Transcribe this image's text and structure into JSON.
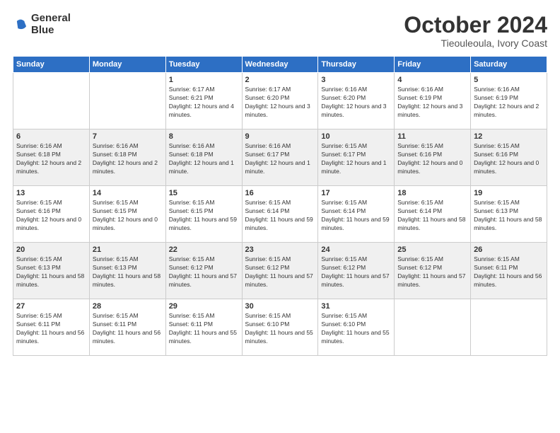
{
  "logo": {
    "line1": "General",
    "line2": "Blue"
  },
  "title": {
    "month": "October 2024",
    "location": "Tieouleoula, Ivory Coast"
  },
  "weekdays": [
    "Sunday",
    "Monday",
    "Tuesday",
    "Wednesday",
    "Thursday",
    "Friday",
    "Saturday"
  ],
  "weeks": [
    [
      {
        "day": "",
        "sunrise": "",
        "sunset": "",
        "daylight": ""
      },
      {
        "day": "",
        "sunrise": "",
        "sunset": "",
        "daylight": ""
      },
      {
        "day": "1",
        "sunrise": "Sunrise: 6:17 AM",
        "sunset": "Sunset: 6:21 PM",
        "daylight": "Daylight: 12 hours and 4 minutes."
      },
      {
        "day": "2",
        "sunrise": "Sunrise: 6:17 AM",
        "sunset": "Sunset: 6:20 PM",
        "daylight": "Daylight: 12 hours and 3 minutes."
      },
      {
        "day": "3",
        "sunrise": "Sunrise: 6:16 AM",
        "sunset": "Sunset: 6:20 PM",
        "daylight": "Daylight: 12 hours and 3 minutes."
      },
      {
        "day": "4",
        "sunrise": "Sunrise: 6:16 AM",
        "sunset": "Sunset: 6:19 PM",
        "daylight": "Daylight: 12 hours and 3 minutes."
      },
      {
        "day": "5",
        "sunrise": "Sunrise: 6:16 AM",
        "sunset": "Sunset: 6:19 PM",
        "daylight": "Daylight: 12 hours and 2 minutes."
      }
    ],
    [
      {
        "day": "6",
        "sunrise": "Sunrise: 6:16 AM",
        "sunset": "Sunset: 6:18 PM",
        "daylight": "Daylight: 12 hours and 2 minutes."
      },
      {
        "day": "7",
        "sunrise": "Sunrise: 6:16 AM",
        "sunset": "Sunset: 6:18 PM",
        "daylight": "Daylight: 12 hours and 2 minutes."
      },
      {
        "day": "8",
        "sunrise": "Sunrise: 6:16 AM",
        "sunset": "Sunset: 6:18 PM",
        "daylight": "Daylight: 12 hours and 1 minute."
      },
      {
        "day": "9",
        "sunrise": "Sunrise: 6:16 AM",
        "sunset": "Sunset: 6:17 PM",
        "daylight": "Daylight: 12 hours and 1 minute."
      },
      {
        "day": "10",
        "sunrise": "Sunrise: 6:15 AM",
        "sunset": "Sunset: 6:17 PM",
        "daylight": "Daylight: 12 hours and 1 minute."
      },
      {
        "day": "11",
        "sunrise": "Sunrise: 6:15 AM",
        "sunset": "Sunset: 6:16 PM",
        "daylight": "Daylight: 12 hours and 0 minutes."
      },
      {
        "day": "12",
        "sunrise": "Sunrise: 6:15 AM",
        "sunset": "Sunset: 6:16 PM",
        "daylight": "Daylight: 12 hours and 0 minutes."
      }
    ],
    [
      {
        "day": "13",
        "sunrise": "Sunrise: 6:15 AM",
        "sunset": "Sunset: 6:16 PM",
        "daylight": "Daylight: 12 hours and 0 minutes."
      },
      {
        "day": "14",
        "sunrise": "Sunrise: 6:15 AM",
        "sunset": "Sunset: 6:15 PM",
        "daylight": "Daylight: 12 hours and 0 minutes."
      },
      {
        "day": "15",
        "sunrise": "Sunrise: 6:15 AM",
        "sunset": "Sunset: 6:15 PM",
        "daylight": "Daylight: 11 hours and 59 minutes."
      },
      {
        "day": "16",
        "sunrise": "Sunrise: 6:15 AM",
        "sunset": "Sunset: 6:14 PM",
        "daylight": "Daylight: 11 hours and 59 minutes."
      },
      {
        "day": "17",
        "sunrise": "Sunrise: 6:15 AM",
        "sunset": "Sunset: 6:14 PM",
        "daylight": "Daylight: 11 hours and 59 minutes."
      },
      {
        "day": "18",
        "sunrise": "Sunrise: 6:15 AM",
        "sunset": "Sunset: 6:14 PM",
        "daylight": "Daylight: 11 hours and 58 minutes."
      },
      {
        "day": "19",
        "sunrise": "Sunrise: 6:15 AM",
        "sunset": "Sunset: 6:13 PM",
        "daylight": "Daylight: 11 hours and 58 minutes."
      }
    ],
    [
      {
        "day": "20",
        "sunrise": "Sunrise: 6:15 AM",
        "sunset": "Sunset: 6:13 PM",
        "daylight": "Daylight: 11 hours and 58 minutes."
      },
      {
        "day": "21",
        "sunrise": "Sunrise: 6:15 AM",
        "sunset": "Sunset: 6:13 PM",
        "daylight": "Daylight: 11 hours and 58 minutes."
      },
      {
        "day": "22",
        "sunrise": "Sunrise: 6:15 AM",
        "sunset": "Sunset: 6:12 PM",
        "daylight": "Daylight: 11 hours and 57 minutes."
      },
      {
        "day": "23",
        "sunrise": "Sunrise: 6:15 AM",
        "sunset": "Sunset: 6:12 PM",
        "daylight": "Daylight: 11 hours and 57 minutes."
      },
      {
        "day": "24",
        "sunrise": "Sunrise: 6:15 AM",
        "sunset": "Sunset: 6:12 PM",
        "daylight": "Daylight: 11 hours and 57 minutes."
      },
      {
        "day": "25",
        "sunrise": "Sunrise: 6:15 AM",
        "sunset": "Sunset: 6:12 PM",
        "daylight": "Daylight: 11 hours and 57 minutes."
      },
      {
        "day": "26",
        "sunrise": "Sunrise: 6:15 AM",
        "sunset": "Sunset: 6:11 PM",
        "daylight": "Daylight: 11 hours and 56 minutes."
      }
    ],
    [
      {
        "day": "27",
        "sunrise": "Sunrise: 6:15 AM",
        "sunset": "Sunset: 6:11 PM",
        "daylight": "Daylight: 11 hours and 56 minutes."
      },
      {
        "day": "28",
        "sunrise": "Sunrise: 6:15 AM",
        "sunset": "Sunset: 6:11 PM",
        "daylight": "Daylight: 11 hours and 56 minutes."
      },
      {
        "day": "29",
        "sunrise": "Sunrise: 6:15 AM",
        "sunset": "Sunset: 6:11 PM",
        "daylight": "Daylight: 11 hours and 55 minutes."
      },
      {
        "day": "30",
        "sunrise": "Sunrise: 6:15 AM",
        "sunset": "Sunset: 6:10 PM",
        "daylight": "Daylight: 11 hours and 55 minutes."
      },
      {
        "day": "31",
        "sunrise": "Sunrise: 6:15 AM",
        "sunset": "Sunset: 6:10 PM",
        "daylight": "Daylight: 11 hours and 55 minutes."
      },
      {
        "day": "",
        "sunrise": "",
        "sunset": "",
        "daylight": ""
      },
      {
        "day": "",
        "sunrise": "",
        "sunset": "",
        "daylight": ""
      }
    ]
  ]
}
